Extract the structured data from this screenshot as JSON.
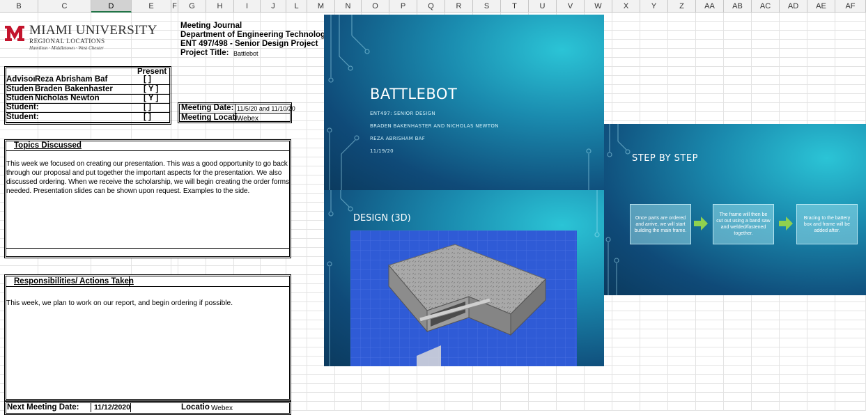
{
  "columns": [
    "B",
    "C",
    "D",
    "E",
    "F",
    "G",
    "H",
    "I",
    "J",
    "L",
    "M",
    "N",
    "O",
    "P",
    "Q",
    "R",
    "S",
    "T",
    "U",
    "V",
    "W",
    "X",
    "Y",
    "Z",
    "AA",
    "AB",
    "AC",
    "AD",
    "AE",
    "AF"
  ],
  "selected_column": "D",
  "logo": {
    "title": "MIAMI UNIVERSITY",
    "subtitle": "REGIONAL LOCATIONS",
    "locations": "Hamilton · Middletown · West Chester",
    "brand_color": "#c3142d"
  },
  "header": {
    "line1": "Meeting Journal",
    "line2": "Department of Engineering Technology",
    "line3": "ENT 497/498 - Senior Design Project",
    "project_label": "Project Title:",
    "project_value": "Battlebot"
  },
  "people": {
    "present_label": "Present",
    "rows": [
      {
        "role": "Advisoı",
        "name": "Reza Abrisham Baf",
        "present": "[ ]"
      },
      {
        "role": "Studen",
        "name": "Braden Bakenhaster",
        "present": "[ Y ]"
      },
      {
        "role": "Studen",
        "name": "Nicholas Newton",
        "present": "[ Y ]"
      },
      {
        "role": "Student:",
        "name": "",
        "present": "[ ]"
      },
      {
        "role": "Student:",
        "name": "",
        "present": "[ ]"
      }
    ]
  },
  "meeting": {
    "date_label": "Meeting Date:",
    "date_value": "11/5/20 and 11/10/20",
    "location_label": "Meeting Locati",
    "location_value": "Webex"
  },
  "topics": {
    "title": "Topics Discussed",
    "lines": [
      "This week we focused on creating our presentation.  This was a good opportunity to go back",
      "through our proposal and put together the important aspects for the presentation.  We also",
      "discussed ordering.  When we receive the scholarship, we will begin creating the order forms",
      "needed.  Presentation slides can be shown upon request.  Examples to the side."
    ]
  },
  "responsibilities": {
    "title": "Responsibilities/ Actions Taken",
    "lines": [
      "This week, we plan to work on our report, and begin ordering if possible."
    ]
  },
  "next_meeting": {
    "label": "Next Meeting Date:",
    "value": "11/12/2020",
    "location_label": "Locatio",
    "location_value": "Webex"
  },
  "slide_title": {
    "title": "BATTLEBOT",
    "lines": [
      "ENT497: SENIOR DESIGN",
      "BRADEN BAKENHASTER AND NICHOLAS NEWTON",
      "REZA ABRISHAM BAF",
      "11/19/20"
    ]
  },
  "slide_steps": {
    "title": "STEP BY STEP",
    "steps": [
      "Once parts are ordered and arrive, we will start building the main frame.",
      "The frame will then be cut out using a band saw and welded/fastened together.",
      "Bracing to the battery box and frame will be added after."
    ]
  },
  "slide_design": {
    "title": "DESIGN (3D)"
  }
}
